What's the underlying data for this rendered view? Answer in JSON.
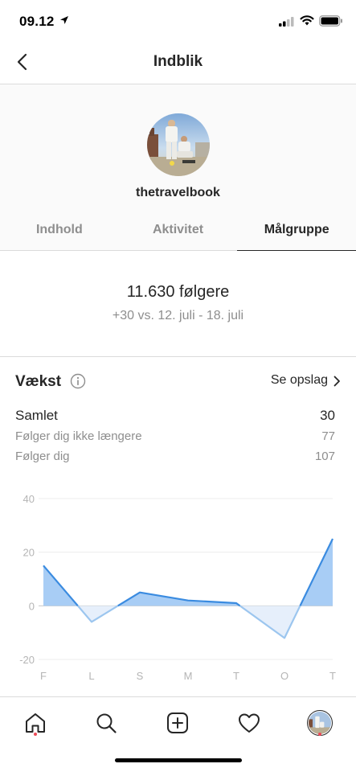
{
  "status_bar": {
    "time": "09.12"
  },
  "header": {
    "title": "Indblik"
  },
  "profile": {
    "username": "thetravelbook"
  },
  "tabs": [
    {
      "label": "Indhold",
      "active": false
    },
    {
      "label": "Aktivitet",
      "active": false
    },
    {
      "label": "Målgruppe",
      "active": true
    }
  ],
  "followers": {
    "count_text": "11.630 følgere",
    "delta_text": "+30 vs. 12. juli - 18. juli"
  },
  "growth": {
    "title": "Vækst",
    "see_posts_label": "Se opslag",
    "stats": [
      {
        "label": "Samlet",
        "value": "30"
      },
      {
        "label": "Følger dig ikke længere",
        "value": "77"
      },
      {
        "label": "Følger dig",
        "value": "107"
      }
    ]
  },
  "chart_data": {
    "type": "area",
    "categories": [
      "F",
      "L",
      "S",
      "M",
      "T",
      "O",
      "T"
    ],
    "values": [
      15,
      -6,
      5,
      2,
      1,
      -12,
      25
    ],
    "ylim": [
      -20,
      40
    ],
    "yticks": [
      40,
      20,
      0,
      -20
    ],
    "grid": true,
    "colors": {
      "positive_fill": "#a8cdf5",
      "negative_fill": "#e6effb",
      "line": "#3a8be0",
      "negative_line": "#9cc6ef"
    }
  },
  "bottom_nav": {
    "items": [
      {
        "icon": "home-icon"
      },
      {
        "icon": "search-icon"
      },
      {
        "icon": "new-post-icon"
      },
      {
        "icon": "heart-icon"
      },
      {
        "icon": "profile-avatar"
      }
    ]
  }
}
